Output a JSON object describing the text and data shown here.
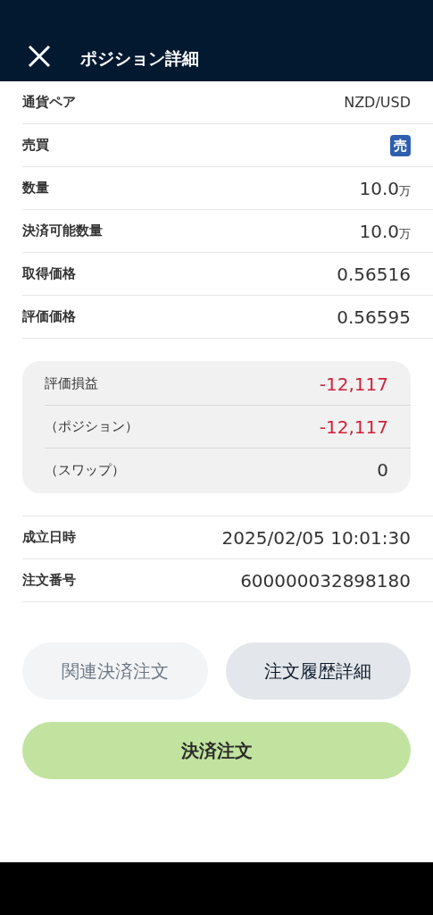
{
  "header": {
    "title": "ポジション詳細"
  },
  "details": [
    {
      "kind": "text",
      "label": "通貨ペア",
      "value": "NZD/USD"
    },
    {
      "kind": "badge",
      "label": "売買",
      "value": "売"
    },
    {
      "kind": "amount",
      "label": "数量",
      "value": "10.0",
      "unit": "万"
    },
    {
      "kind": "amount",
      "label": "決済可能数量",
      "value": "10.0",
      "unit": "万"
    },
    {
      "kind": "large",
      "label": "取得価格",
      "value": "0.56516"
    },
    {
      "kind": "large",
      "label": "評価価格",
      "value": "0.56595"
    }
  ],
  "pnl": [
    {
      "label": "評価損益",
      "value": "-12,117",
      "color": "#d0213a"
    },
    {
      "label": "（ポジション）",
      "value": "-12,117",
      "color": "#d0213a"
    },
    {
      "label": "（スワップ）",
      "value": "0",
      "color": "#333333"
    }
  ],
  "order_info": [
    {
      "kind": "large",
      "label": "成立日時",
      "value": "2025/02/05 10:01:30"
    },
    {
      "kind": "large",
      "label": "注文番号",
      "value": "600000032898180"
    }
  ],
  "buttons": [
    {
      "label": "関連決済注文",
      "disabled": true
    },
    {
      "label": "注文履歴詳細",
      "disabled": false
    }
  ],
  "primary_button": {
    "label": "決済注文"
  }
}
